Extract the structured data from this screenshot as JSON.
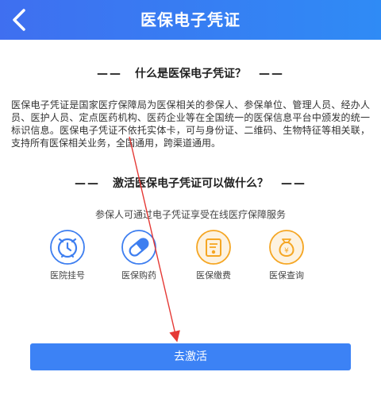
{
  "header": {
    "title": "医保电子凭证",
    "back_icon": "chevron-left-icon"
  },
  "section1": {
    "dash_left": "——",
    "title": "什么是医保电子凭证？",
    "dash_right": "——"
  },
  "intro": "医保电子凭证是国家医疗保障局为医保相关的参保人、参保单位、管理人员、经办人员、医护人员、定点医药机构、医药企业等在全国统一的医保信息平台中颁发的统一标识信息。医保电子凭证不依托实体卡，可与身份证、二维码、生物特征等相关联，支持所有医保相关业务，全国通用，跨渠道通用。",
  "section2": {
    "dash_left": "——",
    "title": "激活医保电子凭证可以做什么？",
    "dash_right": "——"
  },
  "subtitle": "参保人可通过电子凭证享受在线医疗保障服务",
  "services": [
    {
      "label": "医院挂号",
      "icon": "alarm-clock-icon",
      "color": "#3d7ef0"
    },
    {
      "label": "医保购药",
      "icon": "pill-capsule-icon",
      "color": "#3d7ef0"
    },
    {
      "label": "医保缴费",
      "icon": "payment-card-icon",
      "color": "#f5a623"
    },
    {
      "label": "医保查询",
      "icon": "money-bag-icon",
      "color": "#f5a623"
    }
  ],
  "activate_button": "去激活",
  "colors": {
    "header": "#3f6ff0",
    "button": "#3c82f5",
    "annotation_arrow": "#e53935"
  }
}
